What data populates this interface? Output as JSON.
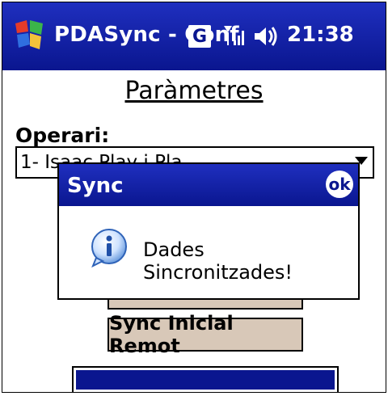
{
  "titlebar": {
    "app_title": "PDASync - Conf",
    "network_badge": "G",
    "clock": "21:38",
    "icons": [
      "windows-start-icon",
      "network-g-icon",
      "signal-icon",
      "speaker-icon"
    ]
  },
  "page": {
    "title": "Paràmetres",
    "operari_label": "Operari:",
    "operari_value": "1- Isaac Play i Pla",
    "sync_button_label": "Sync Inicial Remot",
    "progress": 1.0
  },
  "dialog": {
    "title": "Sync",
    "ok_label": "ok",
    "message": "Dades Sincronitzades!",
    "icon": "info-icon"
  },
  "colors": {
    "titlebar": "#0a168f",
    "button_bg": "#d8c8b8",
    "progress_fill": "#0a168f"
  }
}
